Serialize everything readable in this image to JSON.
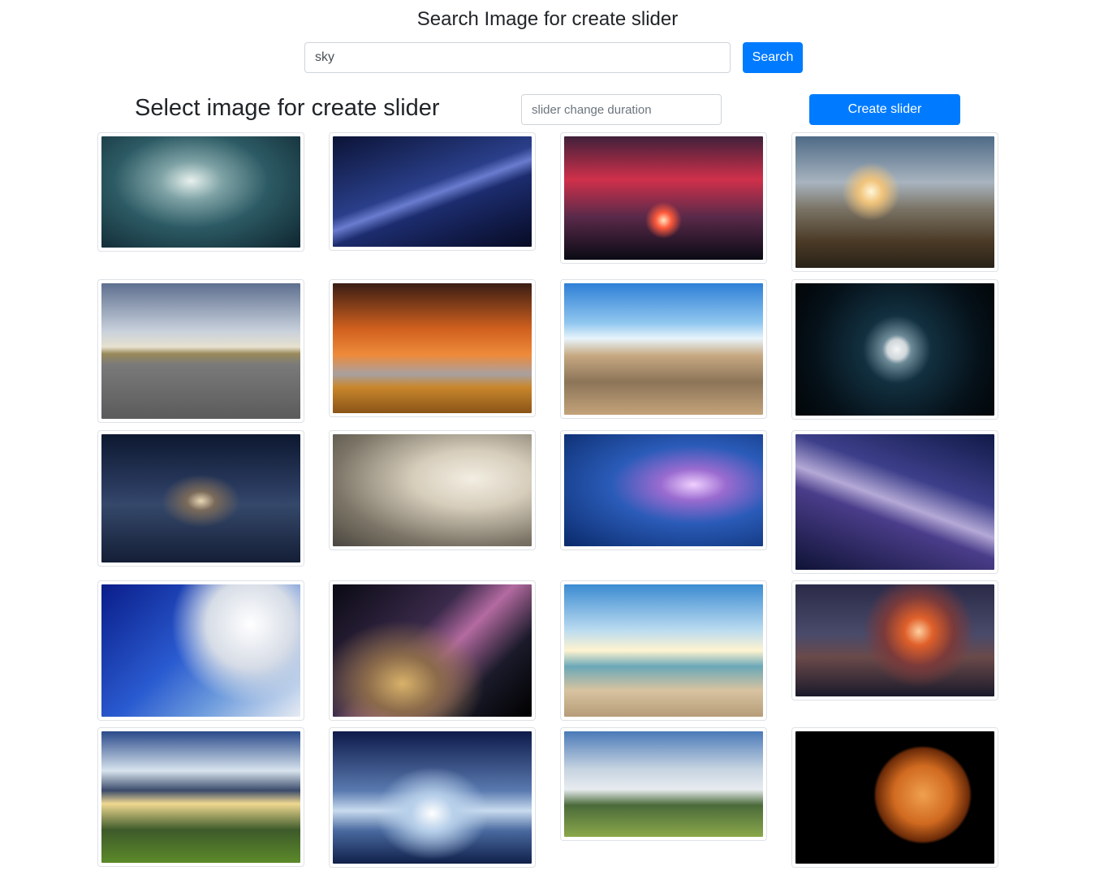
{
  "header": {
    "title": "Search Image for create slider"
  },
  "search": {
    "value": "sky",
    "button_label": "Search"
  },
  "slider_section": {
    "title": "Select image for create slider",
    "duration_placeholder": "slider change duration",
    "create_button_label": "Create slider"
  },
  "images": [
    {
      "name": "clouds-teal-image"
    },
    {
      "name": "milky-way-blue-image"
    },
    {
      "name": "red-sky-tree-image"
    },
    {
      "name": "mountain-sunset-image"
    },
    {
      "name": "road-image"
    },
    {
      "name": "orange-sky-field-image"
    },
    {
      "name": "pier-image"
    },
    {
      "name": "full-moon-image"
    },
    {
      "name": "sea-night-boat-image"
    },
    {
      "name": "cloud-woman-image"
    },
    {
      "name": "lightning-clouds-image"
    },
    {
      "name": "galaxy-purple-image"
    },
    {
      "name": "balloons-sky-image"
    },
    {
      "name": "milky-way-person-image"
    },
    {
      "name": "beach-birds-image"
    },
    {
      "name": "storm-sea-image"
    },
    {
      "name": "hills-sunrays-image"
    },
    {
      "name": "tree-reflection-image"
    },
    {
      "name": "cloud-field-tree-image"
    },
    {
      "name": "orange-moon-cat-image"
    }
  ]
}
